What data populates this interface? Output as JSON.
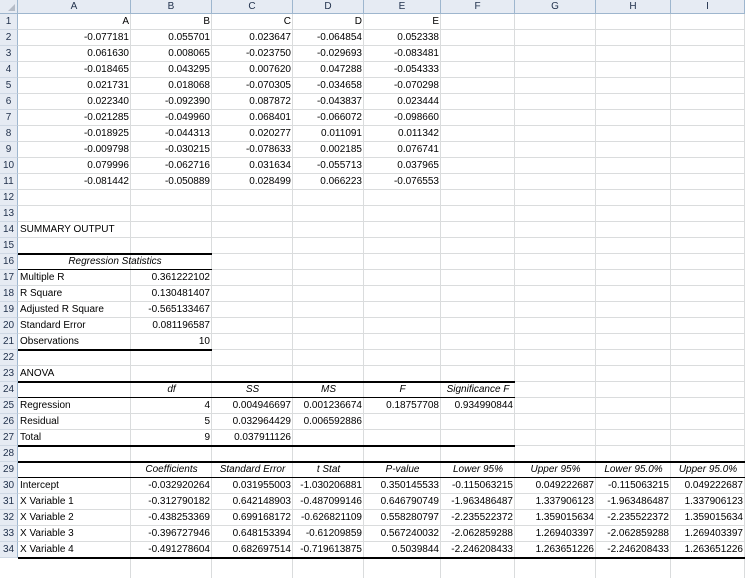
{
  "columns": [
    "A",
    "B",
    "C",
    "D",
    "E",
    "F",
    "G",
    "H",
    "I"
  ],
  "rows": [
    "1",
    "2",
    "3",
    "4",
    "5",
    "6",
    "7",
    "8",
    "9",
    "10",
    "11",
    "12",
    "13",
    "14",
    "15",
    "16",
    "17",
    "18",
    "19",
    "20",
    "21",
    "22",
    "23",
    "24",
    "25",
    "26",
    "27",
    "28",
    "29",
    "30",
    "31",
    "32",
    "33",
    "34"
  ],
  "data_table": {
    "headers": [
      "A",
      "B",
      "C",
      "D",
      "E"
    ],
    "rows": [
      [
        "-0.077181",
        "0.055701",
        "0.023647",
        "-0.064854",
        "0.052338"
      ],
      [
        "0.061630",
        "0.008065",
        "-0.023750",
        "-0.029693",
        "-0.083481"
      ],
      [
        "-0.018465",
        "0.043295",
        "0.007620",
        "0.047288",
        "-0.054333"
      ],
      [
        "0.021731",
        "0.018068",
        "-0.070305",
        "-0.034658",
        "-0.070298"
      ],
      [
        "0.022340",
        "-0.092390",
        "0.087872",
        "-0.043837",
        "0.023444"
      ],
      [
        "-0.021285",
        "-0.049960",
        "0.068401",
        "-0.066072",
        "-0.098660"
      ],
      [
        "-0.018925",
        "-0.044313",
        "0.020277",
        "0.011091",
        "0.011342"
      ],
      [
        "-0.009798",
        "-0.030215",
        "-0.078633",
        "0.002185",
        "0.076741"
      ],
      [
        "0.079996",
        "-0.062716",
        "0.031634",
        "-0.055713",
        "0.037965"
      ],
      [
        "-0.081442",
        "-0.050889",
        "0.028499",
        "0.066223",
        "-0.076553"
      ]
    ]
  },
  "summary_title": "SUMMARY OUTPUT",
  "regression_stats": {
    "title": "Regression Statistics",
    "rows": [
      [
        "Multiple R",
        "0.361222102"
      ],
      [
        "R Square",
        "0.130481407"
      ],
      [
        "Adjusted R Square",
        "-0.565133467"
      ],
      [
        "Standard Error",
        "0.081196587"
      ],
      [
        "Observations",
        "10"
      ]
    ]
  },
  "anova": {
    "title": "ANOVA",
    "headers": [
      "",
      "df",
      "SS",
      "MS",
      "F",
      "Significance F"
    ],
    "rows": [
      [
        "Regression",
        "4",
        "0.004946697",
        "0.001236674",
        "0.18757708",
        "0.934990844"
      ],
      [
        "Residual",
        "5",
        "0.032964429",
        "0.006592886",
        "",
        ""
      ],
      [
        "Total",
        "9",
        "0.037911126",
        "",
        "",
        ""
      ]
    ]
  },
  "coefficients": {
    "headers": [
      "",
      "Coefficients",
      "Standard Error",
      "t Stat",
      "P-value",
      "Lower 95%",
      "Upper 95%",
      "Lower 95.0%",
      "Upper 95.0%"
    ],
    "rows": [
      [
        "Intercept",
        "-0.032920264",
        "0.031955003",
        "-1.030206881",
        "0.350145533",
        "-0.115063215",
        "0.049222687",
        "-0.115063215",
        "0.049222687"
      ],
      [
        "X Variable 1",
        "-0.312790182",
        "0.642148903",
        "-0.487099146",
        "0.646790749",
        "-1.963486487",
        "1.337906123",
        "-1.963486487",
        "1.337906123"
      ],
      [
        "X Variable 2",
        "-0.438253369",
        "0.699168172",
        "-0.626821109",
        "0.558280797",
        "-2.235522372",
        "1.359015634",
        "-2.235522372",
        "1.359015634"
      ],
      [
        "X Variable 3",
        "-0.396727946",
        "0.648153394",
        "-0.61209859",
        "0.567240032",
        "-2.062859288",
        "1.269403397",
        "-2.062859288",
        "1.269403397"
      ],
      [
        "X Variable 4",
        "-0.491278604",
        "0.682697514",
        "-0.719613875",
        "0.5039844",
        "-2.246208433",
        "1.263651226",
        "-2.246208433",
        "1.263651226"
      ]
    ]
  }
}
